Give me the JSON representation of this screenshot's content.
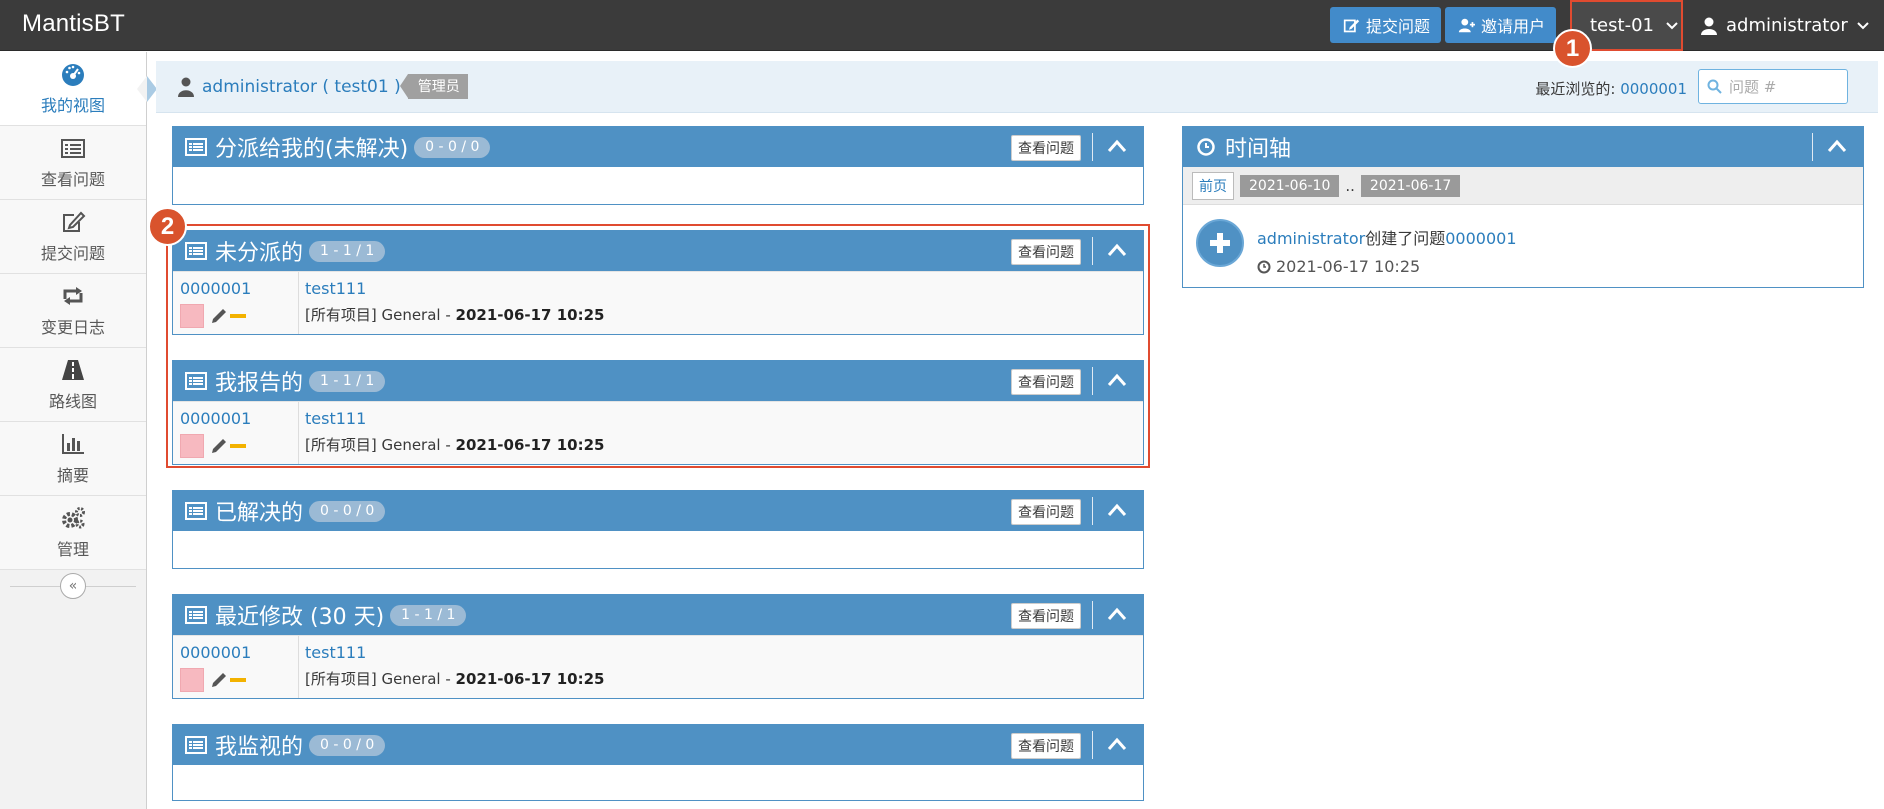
{
  "navbar": {
    "brand": "MantisBT",
    "report_issue": "提交问题",
    "invite_users": "邀请用户",
    "project": "test-01",
    "user": "administrator"
  },
  "callouts": [
    "1",
    "2"
  ],
  "sidebar": {
    "items": [
      {
        "label": "我的视图",
        "icon": "dashboard-icon"
      },
      {
        "label": "查看问题",
        "icon": "list-icon"
      },
      {
        "label": "提交问题",
        "icon": "edit-icon"
      },
      {
        "label": "变更日志",
        "icon": "retweet-icon"
      },
      {
        "label": "路线图",
        "icon": "road-icon"
      },
      {
        "label": "摘要",
        "icon": "bar-chart-icon"
      },
      {
        "label": "管理",
        "icon": "gears-icon"
      }
    ],
    "collapse": "«"
  },
  "breadcrumb": {
    "user": "administrator ( test01 )",
    "role": "管理员",
    "recent_label": "最近浏览的: ",
    "recent_issue": "0000001",
    "search_placeholder": "问题 #"
  },
  "widgets": {
    "assigned": {
      "title": "分派给我的(未解决)",
      "badge": "0 - 0 / 0",
      "button": "查看问题"
    },
    "unassigned": {
      "title": "未分派的",
      "badge": "1 - 1 / 1",
      "button": "查看问题"
    },
    "reported": {
      "title": "我报告的",
      "badge": "1 - 1 / 1",
      "button": "查看问题"
    },
    "resolved": {
      "title": "已解决的",
      "badge": "0 - 0 / 0",
      "button": "查看问题"
    },
    "recent": {
      "title": "最近修改 (30 天)",
      "badge": "1 - 1 / 1",
      "button": "查看问题"
    },
    "monitored": {
      "title": "我监视的",
      "badge": "0 - 0 / 0",
      "button": "查看问题"
    }
  },
  "issue": {
    "id": "0000001",
    "summary": "test111",
    "meta_prefix": "[所有项目] General - ",
    "meta_date": "2021-06-17 10:25"
  },
  "timeline": {
    "title": "时间轴",
    "prev": "前页",
    "from": "2021-06-10",
    "sep": "..",
    "to": "2021-06-17",
    "entry_user": "administrator",
    "entry_action": "创建了问题",
    "entry_issue": "0000001",
    "entry_time": "2021-06-17 10:25"
  },
  "colors": {
    "navbar": "#3b3b3b",
    "accent": "#4f91c4",
    "link": "#2b7dbc",
    "highlight": "#e04b30"
  }
}
